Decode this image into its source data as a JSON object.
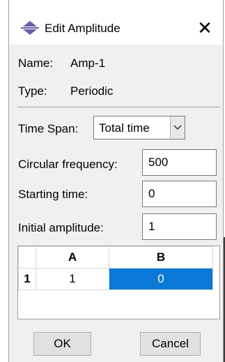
{
  "window": {
    "title": "Edit Amplitude",
    "close_glyph": "✕",
    "icon": "amplitude-icon"
  },
  "info": {
    "name_label": "Name:",
    "name_value": "Amp-1",
    "type_label": "Type:",
    "type_value": "Periodic"
  },
  "time_span": {
    "label": "Time Span:",
    "value": "Total time"
  },
  "fields": {
    "circular_frequency": {
      "label": "Circular frequency:",
      "value": "500"
    },
    "starting_time": {
      "label": "Starting time:",
      "value": "0"
    },
    "initial_amplitude": {
      "label": "Initial amplitude:",
      "value": "1"
    }
  },
  "table": {
    "headers": [
      "A",
      "B"
    ],
    "rows": [
      {
        "index": "1",
        "cells": [
          "1",
          "0"
        ]
      }
    ]
  },
  "buttons": {
    "ok": "OK",
    "cancel": "Cancel"
  },
  "colors": {
    "selection": "#0a78d7",
    "dialog_bg": "#f0f0f0"
  }
}
